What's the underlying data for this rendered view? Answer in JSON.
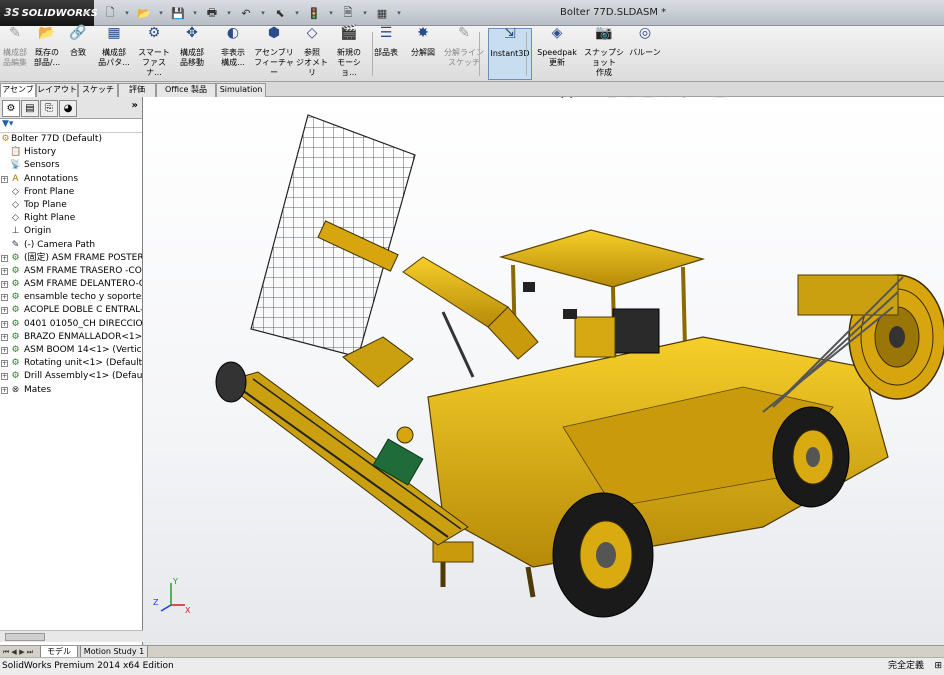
{
  "app": {
    "logo_mark": "3S",
    "logo_text": "SOLIDWORKS",
    "document_title": "Bolter 77D.SLDASM *"
  },
  "quick_access": [
    {
      "icon": "new-icon",
      "glyph": "🗋"
    },
    {
      "icon": "open-icon",
      "glyph": "📂"
    },
    {
      "icon": "save-icon",
      "glyph": "💾"
    },
    {
      "icon": "print-icon",
      "glyph": "🖶"
    },
    {
      "icon": "undo-icon",
      "glyph": "↶"
    },
    {
      "icon": "select-icon",
      "glyph": "⬉"
    },
    {
      "icon": "rebuild-icon",
      "glyph": "🚦"
    },
    {
      "icon": "file-properties-icon",
      "glyph": "🗎"
    },
    {
      "icon": "options-icon",
      "glyph": "▦"
    }
  ],
  "commands": [
    {
      "id": "edit-component",
      "label1": "構成部",
      "label2": "品編集",
      "disabled": true
    },
    {
      "id": "insert-existing",
      "label1": "既存の",
      "label2": "部品/..."
    },
    {
      "id": "mate",
      "label1": "合致",
      "label2": ""
    },
    {
      "id": "component-pattern",
      "label1": "構成部",
      "label2": "品パタ..."
    },
    {
      "id": "smart-fasteners",
      "label1": "スマート",
      "label2": "ファスナ..."
    },
    {
      "id": "move-component",
      "label1": "構成部",
      "label2": "品移動"
    },
    {
      "id": "hide-show",
      "label1": "非表示",
      "label2": "構成..."
    },
    {
      "id": "assembly-features",
      "label1": "アセンブリ",
      "label2": "フィーチャー"
    },
    {
      "id": "reference-geometry",
      "label1": "参照",
      "label2": "ジオメトリ"
    },
    {
      "id": "new-motion-study",
      "label1": "新規の",
      "label2": "モーショ..."
    },
    {
      "id": "bill-of-materials",
      "label1": "部品表",
      "label2": ""
    },
    {
      "id": "exploded-view",
      "label1": "分解図",
      "label2": ""
    },
    {
      "id": "explode-line-sketch",
      "label1": "分解ライン",
      "label2": "スケッチ",
      "disabled": true
    },
    {
      "id": "instant3d",
      "label1": "Instant3D",
      "label2": "",
      "active": true
    },
    {
      "id": "speedpak",
      "label1": "Speedpak",
      "label2": "更新"
    },
    {
      "id": "snapshot",
      "label1": "スナップショット",
      "label2": "作成"
    },
    {
      "id": "balloon",
      "label1": "バルーン",
      "label2": ""
    }
  ],
  "tabs": [
    "アセンブリ",
    "レイアウト",
    "スケッチ",
    "評価",
    "Office 製品",
    "Simulation"
  ],
  "feature_tree": {
    "root": "Bolter 77D  (Default)",
    "items": [
      {
        "label": "History",
        "icon": "history-icon",
        "glyph": "📋",
        "expand": false
      },
      {
        "label": "Sensors",
        "icon": "sensors-icon",
        "glyph": "📡",
        "expand": false
      },
      {
        "label": "Annotations",
        "icon": "annotations-icon",
        "glyph": "A",
        "expand": true
      },
      {
        "label": "Front Plane",
        "icon": "plane-icon",
        "glyph": "◇",
        "expand": false
      },
      {
        "label": "Top Plane",
        "icon": "plane-icon",
        "glyph": "◇",
        "expand": false
      },
      {
        "label": "Right Plane",
        "icon": "plane-icon",
        "glyph": "◇",
        "expand": false
      },
      {
        "label": "Origin",
        "icon": "origin-icon",
        "glyph": "⊥",
        "expand": false
      },
      {
        "label": "(-) Camera Path",
        "icon": "sketch-icon",
        "glyph": "✎",
        "expand": false
      },
      {
        "label": "(固定) ASM FRAME POSTER",
        "icon": "assembly-icon",
        "glyph": "⚙",
        "expand": true
      },
      {
        "label": "ASM FRAME TRASERO -CO",
        "icon": "assembly-icon",
        "glyph": "⚙",
        "expand": true
      },
      {
        "label": "ASM FRAME DELANTERO-C",
        "icon": "assembly-icon",
        "glyph": "⚙",
        "expand": true
      },
      {
        "label": "ensamble techo y soportes",
        "icon": "assembly-icon",
        "glyph": "⚙",
        "expand": true
      },
      {
        "label": "ACOPLE DOBLE C ENTRAL-",
        "icon": "assembly-icon",
        "glyph": "⚙",
        "expand": true
      },
      {
        "label": "0401 01050_CH DIRECCIOI",
        "icon": "assembly-icon",
        "glyph": "⚙",
        "expand": true
      },
      {
        "label": "BRAZO ENMALLADOR<1>",
        "icon": "assembly-icon",
        "glyph": "⚙",
        "expand": true
      },
      {
        "label": "ASM BOOM 14<1> (Vertic",
        "icon": "assembly-icon",
        "glyph": "⚙",
        "expand": true
      },
      {
        "label": "Rotating unit<1> (Default_",
        "icon": "assembly-icon",
        "glyph": "⚙",
        "expand": true
      },
      {
        "label": "Drill Assembly<1> (Default",
        "icon": "assembly-icon",
        "glyph": "⚙",
        "expand": true
      },
      {
        "label": "Mates",
        "icon": "mates-icon",
        "glyph": "⊗",
        "expand": true
      }
    ]
  },
  "bottom_tabs": [
    "モデル",
    "Motion Study 1"
  ],
  "status": {
    "left": "SolidWorks Premium 2014 x64 Edition",
    "right": "完全定義",
    "right_extra": "⊞"
  },
  "triad": {
    "x": "X",
    "y": "Y",
    "z": "Z"
  },
  "colors": {
    "machine": "#e0b012",
    "machine_dark": "#8a6a05",
    "accent_active": "#c9ddf0"
  }
}
